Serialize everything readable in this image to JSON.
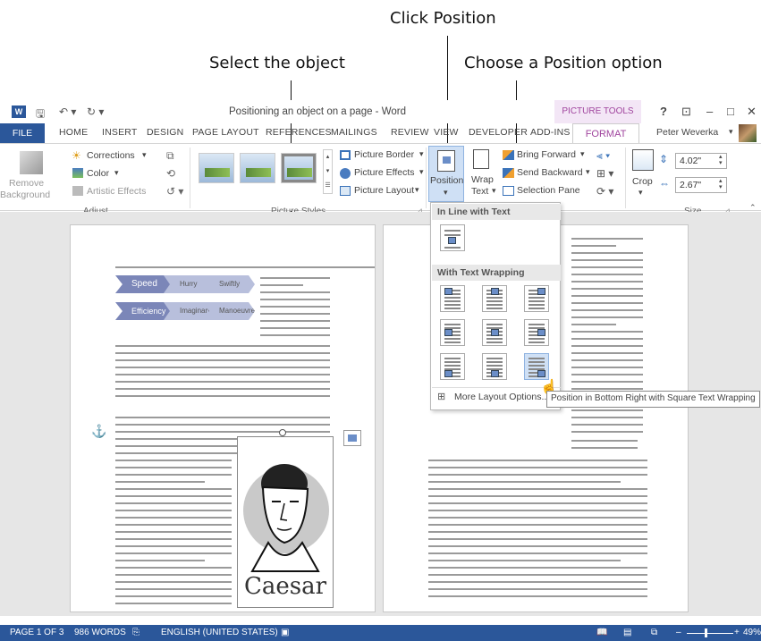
{
  "callouts": {
    "click_position": "Click Position",
    "select_object": "Select the object",
    "choose_option": "Choose a Position option"
  },
  "titlebar": {
    "doc_title": "Positioning an object on a page - Word",
    "context_tab": "PICTURE TOOLS",
    "help": "?",
    "minimize": "–",
    "restore": "□",
    "close": "✕"
  },
  "tabs": [
    "FILE",
    "HOME",
    "INSERT",
    "DESIGN",
    "PAGE LAYOUT",
    "REFERENCES",
    "MAILINGS",
    "REVIEW",
    "VIEW",
    "DEVELOPER",
    "ADD-INS",
    "FORMAT"
  ],
  "user": "Peter Weverka",
  "ribbon": {
    "remove_background_1": "Remove",
    "remove_background_2": "Background",
    "corrections": "Corrections",
    "color": "Color",
    "artistic_effects": "Artistic Effects",
    "group_adjust": "Adjust",
    "picture_border": "Picture Border",
    "picture_effects": "Picture Effects",
    "picture_layout": "Picture Layout",
    "group_picture_styles": "Picture Styles",
    "position": "Position",
    "wrap_1": "Wrap",
    "wrap_2": "Text",
    "bring_forward": "Bring Forward",
    "send_backward": "Send Backward",
    "selection_pane": "Selection Pane",
    "crop": "Crop",
    "height": "4.02\"",
    "width": "2.67\"",
    "group_size": "Size"
  },
  "smartart": {
    "row1": [
      "Speed",
      "Hurry",
      "Swiftly"
    ],
    "row2": [
      "Efficiency",
      "Imaginary",
      "Manoeuvre"
    ]
  },
  "caesar_label": "Caesar",
  "position_menu": {
    "inline_header": "In Line with Text",
    "wrap_header": "With Text Wrapping",
    "more_options": "More Layout Options...",
    "tooltip": "Position in Bottom Right with Square Text Wrapping"
  },
  "status": {
    "page": "PAGE 1 OF 3",
    "words": "986 WORDS",
    "language": "ENGLISH (UNITED STATES)",
    "zoom": "49%"
  },
  "colors": {
    "word_blue": "#2b579a",
    "picture_tools": "#a0459e",
    "smartart_dark": "#7b86b8",
    "smartart_light": "#b8bfdc",
    "hover_option": "#cfe0f5"
  }
}
